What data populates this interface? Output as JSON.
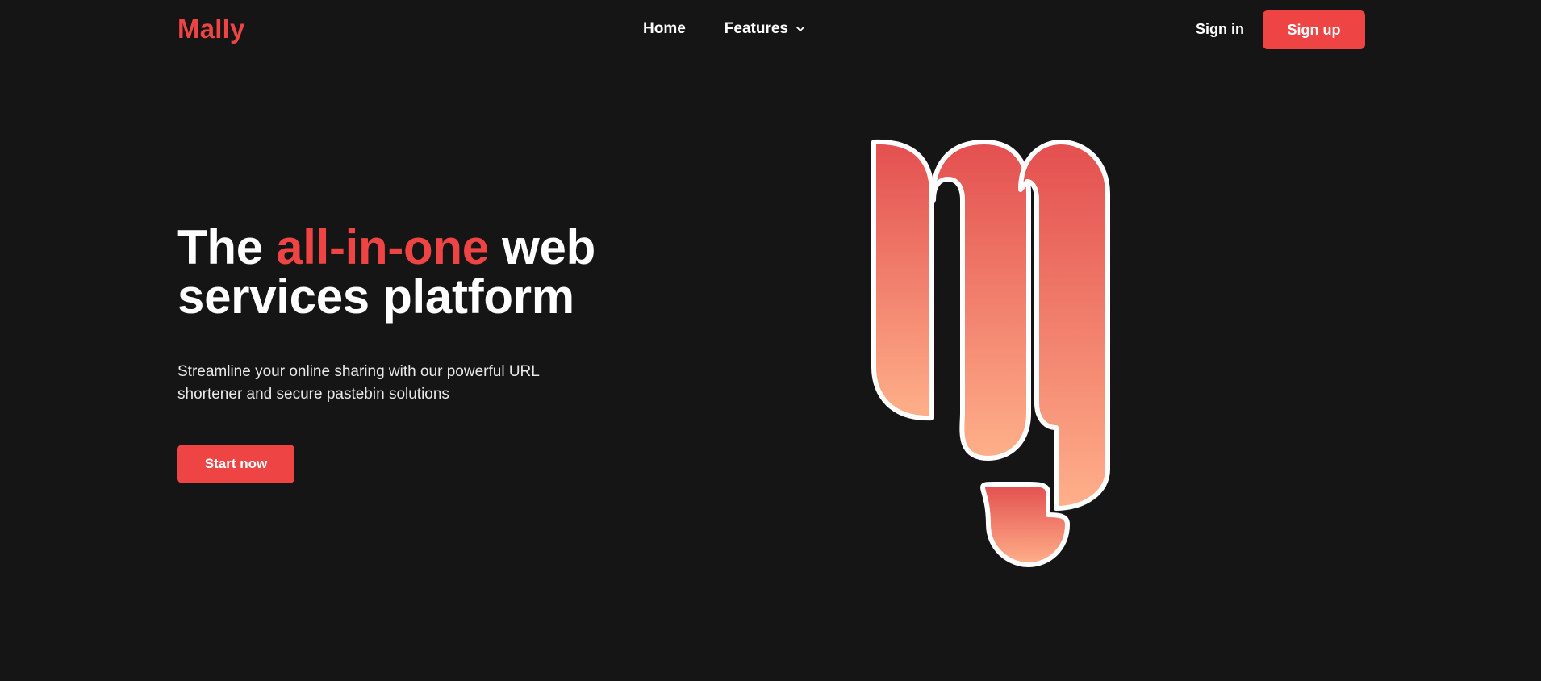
{
  "colors": {
    "background": "#151515",
    "accent": "#ef4444",
    "gradient_top": "#e34f4f",
    "gradient_bottom": "#ffb08a",
    "text": "#ffffff"
  },
  "nav": {
    "logo_text": "Mally",
    "links": [
      {
        "label": "Home"
      },
      {
        "label": "Features",
        "icon": "chevron-down-icon"
      }
    ],
    "signin_label": "Sign in",
    "signup_label": "Sign up"
  },
  "hero": {
    "headline_part1": "The ",
    "headline_accent": "all-in-one",
    "headline_part2": " web",
    "headline_line2": "services platform",
    "subtitle": "Streamline your online sharing with our powerful URL shortener and secure pastebin solutions",
    "cta_label": "Start now",
    "illustration": "mally-m-logo"
  }
}
